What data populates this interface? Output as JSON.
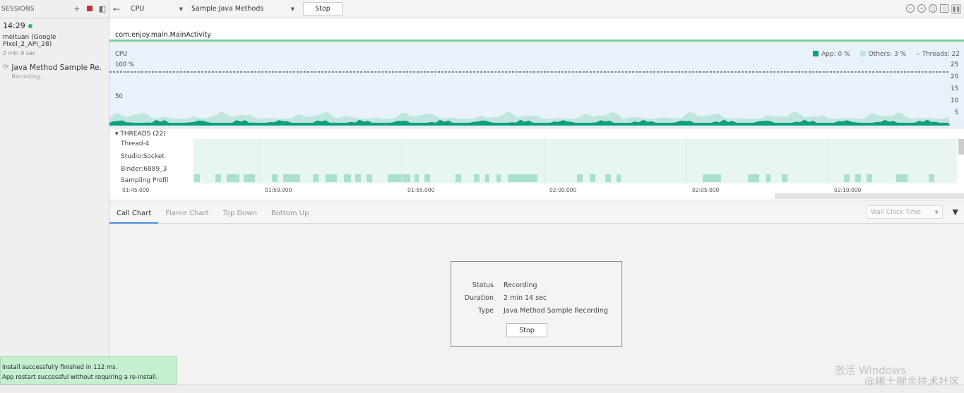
{
  "sidebar": {
    "header": "SESSIONS",
    "session_time": "14:29",
    "device": "meituan (Google Pixel_2_API_28)",
    "duration": "2 min 9 sec",
    "recording_label": "Java Method Sample Re...",
    "recording_status": "Recording..."
  },
  "toolbar": {
    "profiler": "CPU",
    "config": "Sample Java Methods",
    "stop_label": "Stop"
  },
  "activity": "com.enjoy.main.MainActivity",
  "cpu": {
    "label": "CPU",
    "y_top": "100 %",
    "y_mid": "50",
    "legend_app": "App: 0 %",
    "legend_others": "Others: 3 %",
    "legend_threads": "Threads: 22",
    "right_axis": [
      "25",
      "20",
      "15",
      "10",
      "5"
    ],
    "colors": {
      "app": "#0e9f7c",
      "others": "#bfe6dd"
    }
  },
  "threads": {
    "header": "THREADS (22)",
    "rows": [
      "Thread-4",
      "Studio:Socket",
      "Binder:6889_3",
      "Sampling Profil"
    ]
  },
  "ruler": [
    "01:45.000",
    "01:50.000",
    "01:55.000",
    "02:00.000",
    "02:05.000",
    "02:10.000"
  ],
  "tabs": [
    "Call Chart",
    "Flame Chart",
    "Top Down",
    "Bottom Up"
  ],
  "clock": "Wall Clock Time",
  "status_panel": {
    "status_k": "Status",
    "status_v": "Recording",
    "duration_k": "Duration",
    "duration_v": "2 min 14 sec",
    "type_k": "Type",
    "type_v": "Java Method Sample Recording",
    "stop_label": "Stop"
  },
  "toast": {
    "line1": "Install successfully finished in 112 ms.",
    "line2": "App restart successful without requiring a re-install."
  },
  "watermark": {
    "line1": "激活 Windows",
    "line2": "@稀土掘金技术社区"
  }
}
